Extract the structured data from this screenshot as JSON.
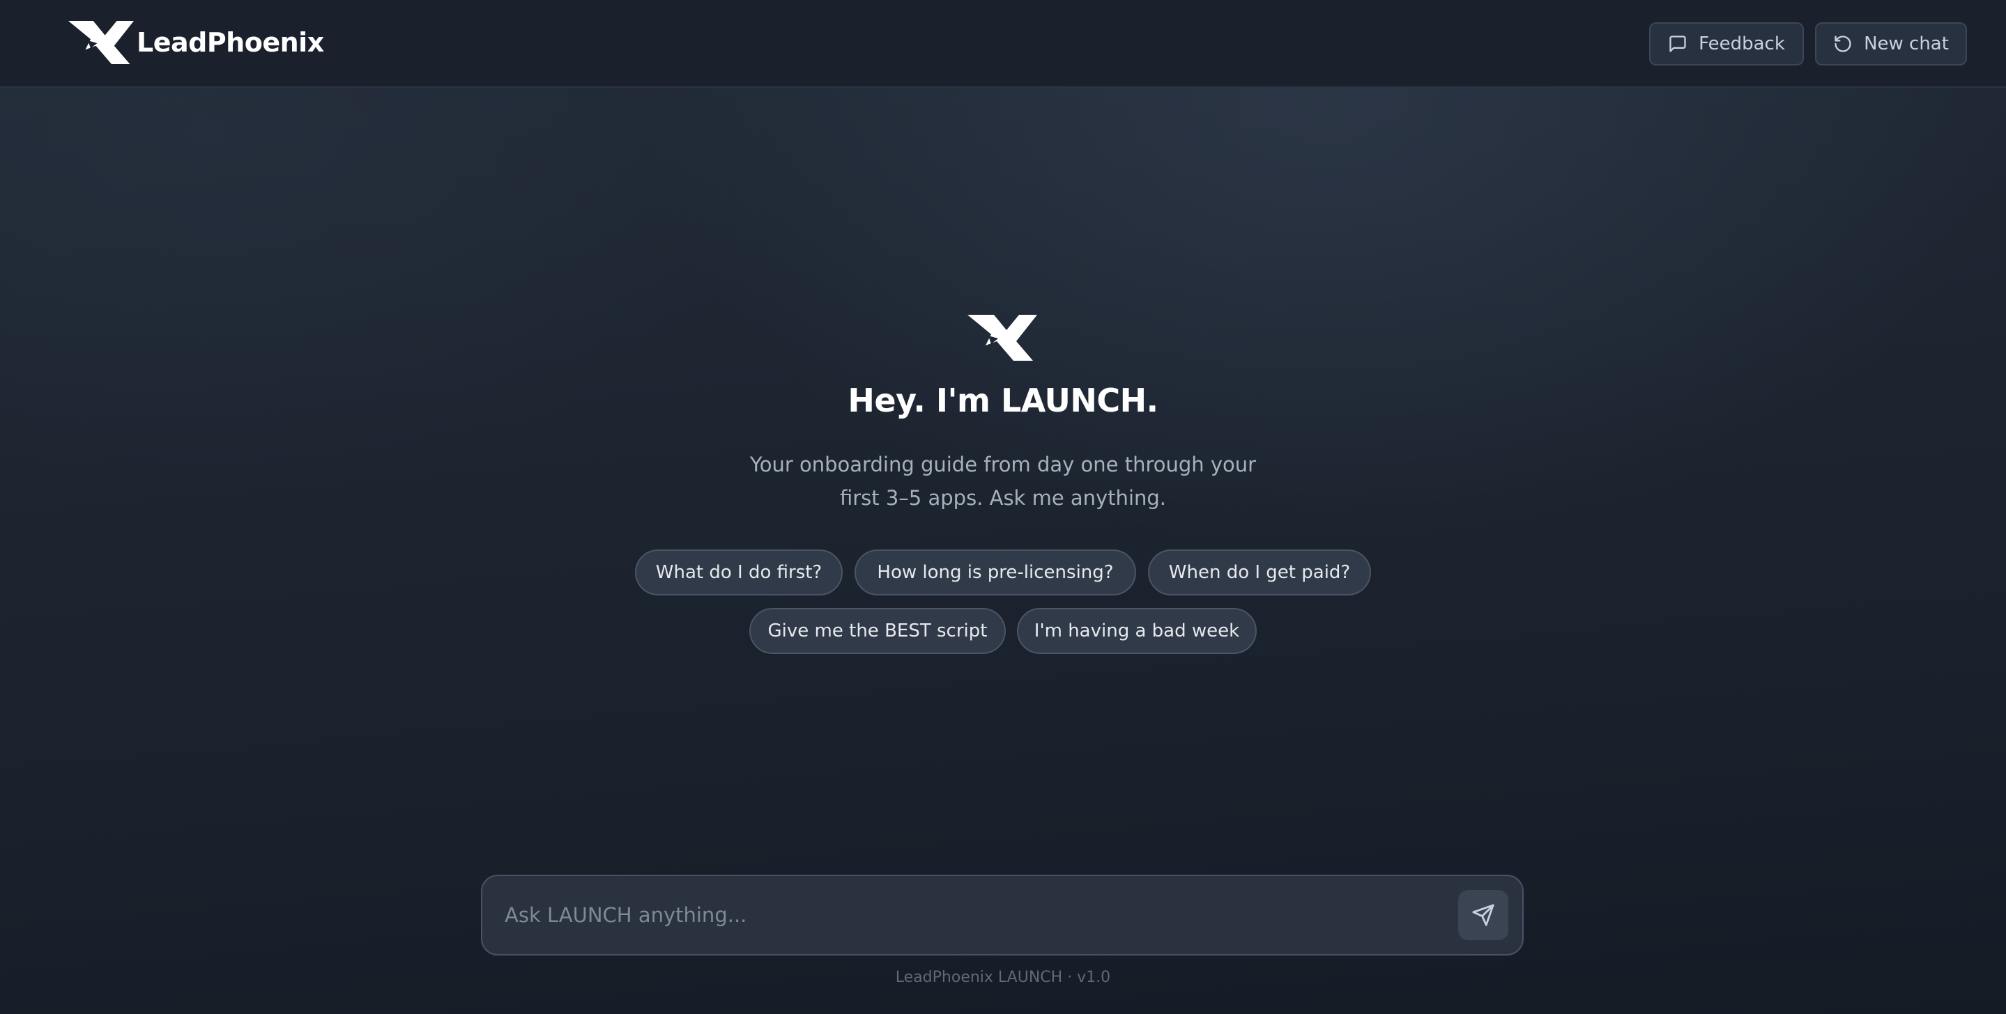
{
  "app": {
    "brand_name": "LeadPhoenix",
    "logo_icon": "leadphoenix-logo"
  },
  "header": {
    "feedback_label": "Feedback",
    "feedback_icon": "message-square-icon",
    "new_chat_label": "New chat",
    "new_chat_icon": "rotate-ccw-icon"
  },
  "hero": {
    "title": "Hey. I'm LAUNCH.",
    "subtitle_line1": "Your onboarding guide from day one through your",
    "subtitle_line2": "first 3–5 apps. Ask me anything."
  },
  "suggestions": [
    "What do I do first?",
    "How long is pre-licensing?",
    "When do I get paid?",
    "Give me the BEST script",
    "I'm having a bad week"
  ],
  "composer": {
    "placeholder": "Ask LAUNCH anything...",
    "value": "",
    "send_icon": "send-icon"
  },
  "footer": {
    "version_text": "LeadPhoenix LAUNCH · v1.0"
  },
  "colors": {
    "background": "#1d2531",
    "header_bg": "#1a212c",
    "chip_bg": "#313a48",
    "chip_border": "#4a5464",
    "text_primary": "#ffffff",
    "text_muted": "#a7b0bd"
  }
}
